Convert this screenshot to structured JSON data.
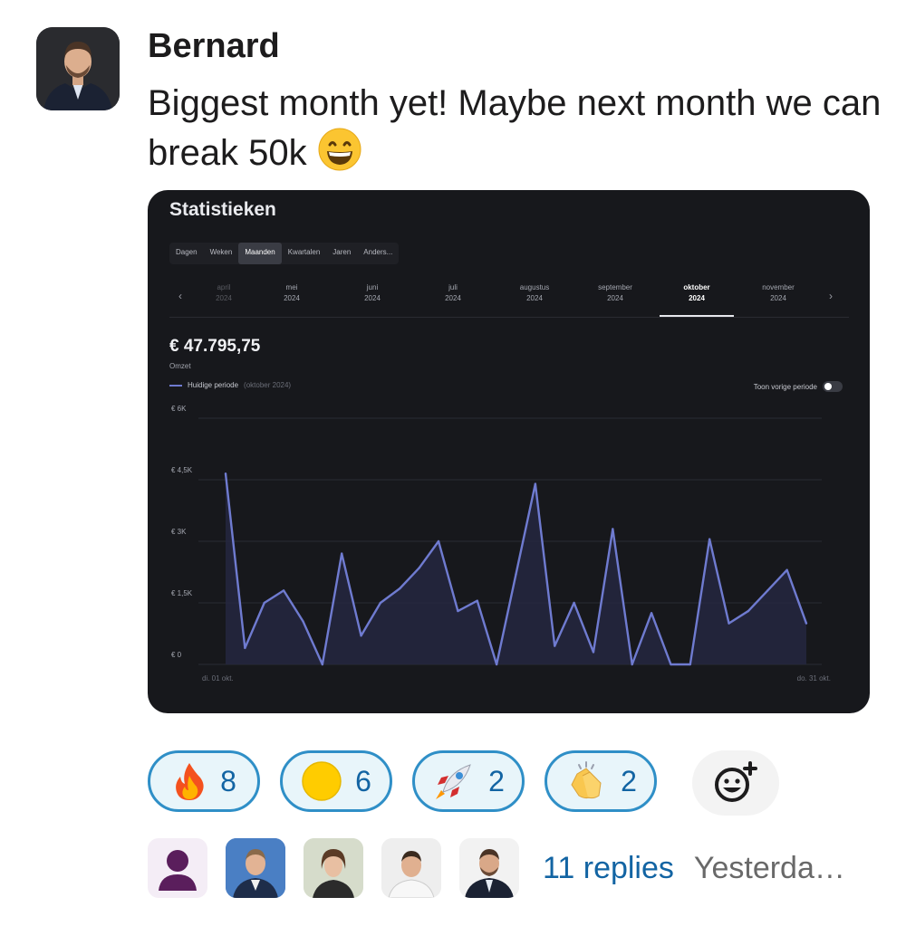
{
  "message": {
    "author": "Bernard",
    "text": "Biggest month yet! Maybe next month we can break 50k"
  },
  "screenshot": {
    "title": "Statistieken",
    "tabs": [
      "Dagen",
      "Weken",
      "Maanden",
      "Kwartalen",
      "Jaren",
      "Anders..."
    ],
    "active_tab": "Maanden",
    "months": [
      {
        "name": "april",
        "year": "2024"
      },
      {
        "name": "mei",
        "year": "2024"
      },
      {
        "name": "juni",
        "year": "2024"
      },
      {
        "name": "juli",
        "year": "2024"
      },
      {
        "name": "augustus",
        "year": "2024"
      },
      {
        "name": "september",
        "year": "2024"
      },
      {
        "name": "oktober",
        "year": "2024"
      },
      {
        "name": "november",
        "year": "2024"
      }
    ],
    "active_month": "oktober",
    "prev_arrow": "‹",
    "next_arrow": "›",
    "total": "€ 47.795,75",
    "total_label": "Omzet",
    "legend_label": "Huidige periode",
    "legend_period": "(oktober 2024)",
    "toggle_label": "Toon vorige periode",
    "chart_data": {
      "type": "area",
      "x_start_label": "di. 01 okt.",
      "x_end_label": "do. 31 okt.",
      "y_ticks": [
        "€ 6K",
        "€ 4,5K",
        "€ 3K",
        "€ 1,5K",
        "€ 0"
      ],
      "ylim": [
        0,
        6000
      ],
      "series_color": "#6f7bd0",
      "days": [
        1,
        2,
        3,
        4,
        5,
        6,
        7,
        8,
        9,
        10,
        11,
        12,
        13,
        14,
        15,
        16,
        17,
        18,
        19,
        20,
        21,
        22,
        23,
        24,
        25,
        26,
        27,
        28,
        29,
        30,
        31
      ],
      "values": [
        4650,
        400,
        1500,
        1800,
        1050,
        0,
        2700,
        700,
        1500,
        1850,
        2350,
        3000,
        1300,
        1550,
        0,
        2200,
        4400,
        450,
        1500,
        300,
        3300,
        0,
        1250,
        0,
        0,
        3050,
        1000,
        1300,
        1800,
        2300,
        1000
      ]
    }
  },
  "reactions": [
    {
      "emoji": "fire",
      "count": "8"
    },
    {
      "emoji": "yellow-circle",
      "count": "6"
    },
    {
      "emoji": "rocket",
      "count": "2"
    },
    {
      "emoji": "clapping-hands",
      "count": "2"
    }
  ],
  "thread": {
    "replies": "11 replies",
    "timestamp": "Yesterda…"
  }
}
